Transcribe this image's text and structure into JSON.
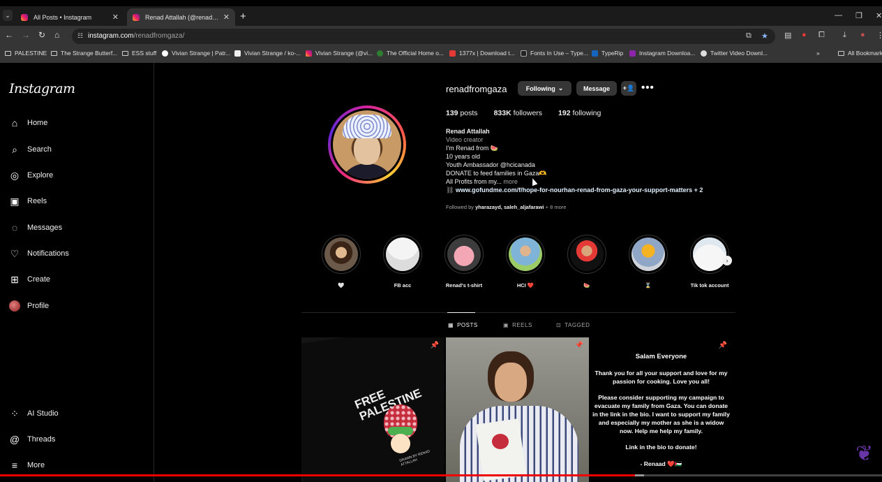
{
  "browser": {
    "tabs": [
      {
        "label": "All Posts • Instagram"
      },
      {
        "label": "Renad Attallah (@renadfromgaza) • Instagram"
      }
    ],
    "url_host": "instagram.com",
    "url_path": "/renadfromgaza/",
    "bookmarks": [
      {
        "label": "PALESTINE",
        "icon": "folder-icon"
      },
      {
        "label": "The Strange Butterf...",
        "icon": "folder-icon"
      },
      {
        "label": "ESS stuff",
        "icon": "folder-icon"
      },
      {
        "label": "Vivian Strange | Patr...",
        "icon": "patreon-icon"
      },
      {
        "label": "Vivian Strange / ko-...",
        "icon": "kofi-icon"
      },
      {
        "label": "Vivian Strange (@vi...",
        "icon": "instagram-icon"
      },
      {
        "label": "The Official Home o...",
        "icon": "site-icon"
      },
      {
        "label": "1377x | Download t...",
        "icon": "x-icon"
      },
      {
        "label": "Fonts In Use – Type...",
        "icon": "fonts-icon"
      },
      {
        "label": "TypeRip",
        "icon": "typerip-icon"
      },
      {
        "label": "Instagram Downloa...",
        "icon": "download-icon"
      },
      {
        "label": "Twitter Video Downl...",
        "icon": "globe-icon"
      },
      {
        "label": "All Bookmarks",
        "icon": "folder-icon"
      }
    ]
  },
  "sidebar": {
    "logo": "Instagram",
    "items": [
      {
        "label": "Home",
        "icon": "home-icon"
      },
      {
        "label": "Search",
        "icon": "search-icon"
      },
      {
        "label": "Explore",
        "icon": "compass-icon"
      },
      {
        "label": "Reels",
        "icon": "reels-icon"
      },
      {
        "label": "Messages",
        "icon": "messenger-icon"
      },
      {
        "label": "Notifications",
        "icon": "heart-icon"
      },
      {
        "label": "Create",
        "icon": "plus-square-icon"
      },
      {
        "label": "Profile",
        "icon": "avatar-icon"
      }
    ],
    "bottom_items": [
      {
        "label": "AI Studio",
        "icon": "ai-studio-icon"
      },
      {
        "label": "Threads",
        "icon": "threads-icon"
      },
      {
        "label": "More",
        "icon": "hamburger-icon"
      }
    ]
  },
  "profile": {
    "username": "renadfromgaza",
    "following_button": "Following",
    "message_button": "Message",
    "stats": {
      "posts_count": "139",
      "posts_label": "posts",
      "followers_count": "833K",
      "followers_label": "followers",
      "following_count": "192",
      "following_label": "following"
    },
    "bio": {
      "name": "Renad Attallah",
      "category": "Video creator",
      "line1": "I'm Renad from 🍉",
      "line2": "10 years old",
      "line3": "Youth Ambassador @hcicanada",
      "line4": "DONATE to feed families in Gaza🫶",
      "line5": "All Profits from my...",
      "more": "more",
      "link": "www.gofundme.com/f/hope-for-nourhan-renad-from-gaza-your-support-matters + 2"
    },
    "followed_by_prefix": "Followed by",
    "followed_by_names": "yharazayd, saleh_aljafarawi",
    "followed_by_more": "+ 8 more"
  },
  "highlights": [
    {
      "label": "🤍"
    },
    {
      "label": "FB acc"
    },
    {
      "label": "Renad's t-shirt"
    },
    {
      "label": "HCI ❤️"
    },
    {
      "label": "🍉"
    },
    {
      "label": "⌛"
    },
    {
      "label": "Tik tok account"
    }
  ],
  "profile_tabs": [
    {
      "label": "POSTS",
      "icon": "grid-icon"
    },
    {
      "label": "REELS",
      "icon": "reels-icon"
    },
    {
      "label": "TAGGED",
      "icon": "tag-icon"
    }
  ],
  "posts": {
    "post1_text": "FREE PALESTINE",
    "post1_caption": "DRAWN BY RENAD ATTALLAH",
    "post3": {
      "title": "Salam Everyone",
      "p1": "Thank you for all your support and love for my passion for cooking. Love you all!",
      "p2": "Please consider supporting my campaign to evacuate my family from Gaza. You can donate in the link in the bio. I want to support my family and especially my mother as she is a widow now. Help me help my family.",
      "p3": "Link in the bio to donate!",
      "signoff": "- Renaad ❤️🇵🇸"
    }
  },
  "video_progress": {
    "played_fraction": 0.72,
    "buffered_fraction": 0.73
  },
  "colors": {
    "background": "#000000",
    "panel": "#363636",
    "muted_text": "#a8a8a8",
    "progress_red": "#ee0000",
    "star_blue": "#8ab4f8"
  }
}
